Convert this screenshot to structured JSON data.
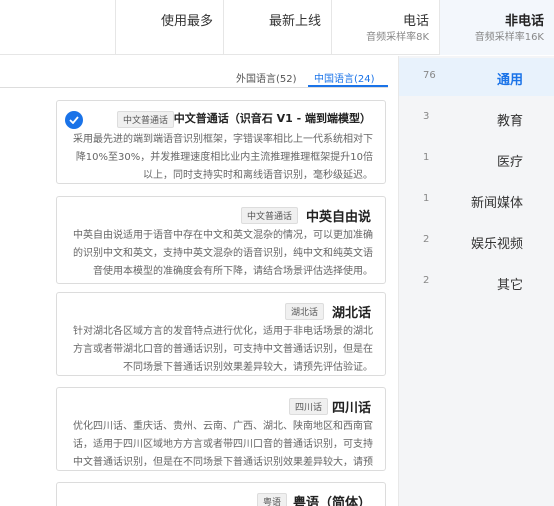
{
  "top_tabs": [
    {
      "title": "使用最多",
      "subtitle": ""
    },
    {
      "title": "最新上线",
      "subtitle": ""
    },
    {
      "title": "电话",
      "subtitle": "音频采样率8K"
    },
    {
      "title": "非电话",
      "subtitle": "音频采样率16K"
    }
  ],
  "sidebar": {
    "items": [
      {
        "label": "通用",
        "count": "76"
      },
      {
        "label": "教育",
        "count": "3"
      },
      {
        "label": "医疗",
        "count": "1"
      },
      {
        "label": "新闻媒体",
        "count": "1"
      },
      {
        "label": "娱乐视频",
        "count": "2"
      },
      {
        "label": "其它",
        "count": "2"
      }
    ]
  },
  "sub_tabs": {
    "chinese": "中国语言(24)",
    "foreign": "外国语言(52)"
  },
  "cards": [
    {
      "title": "中文普通话（识音石 V1 - 端到端模型）",
      "tag": "中文普通话",
      "desc": "采用最先进的端到端语音识别框架，字错误率相比上一代系统相对下降10%至30%，并发推理速度相比业内主流推理推理框架提升10倍以上，同时支持实时和离线语音识别，毫秒级延迟。",
      "selected": true
    },
    {
      "title": "中英自由说",
      "tag": "中文普通话",
      "desc": "中英自由说适用于语音中存在中文和英文混杂的情况，可以更加准确的识别中文和英文，支持中英文混杂的语音识别，纯中文和纯英文语音使用本模型的准确度会有所下降，请结合场景评估选择使用。",
      "selected": false
    },
    {
      "title": "湖北话",
      "tag": "湖北话",
      "desc": "针对湖北各区域方言的发音特点进行优化，适用于非电话场景的湖北方言或者带湖北口音的普通话识别，可支持中文普通话识别，但是在不同场景下普通话识别效果差异较大，请预先评估验证。",
      "selected": false
    },
    {
      "title": "四川话",
      "tag": "四川话",
      "desc": "优化四川话、重庆话、贵州、云南、广西、湖北、陕南地区和西南官话，适用于四川区域地方方言或者带四川口音的普通话识别，可支持中文普通话识别，但是在不同场景下普通话识别效果差异较大，请预先评估验证。",
      "selected": false
    },
    {
      "title": "粤语（简体）",
      "tag": "粤语",
      "desc": "",
      "selected": false
    }
  ]
}
